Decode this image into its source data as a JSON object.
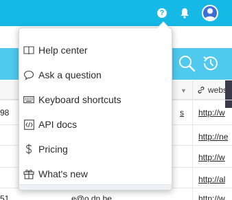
{
  "topbar": {
    "icons": [
      "help-icon",
      "bell-icon",
      "avatar"
    ],
    "help_glyph": "?",
    "accent_color": "#16b8e6",
    "status_color": "#3ccf4e"
  },
  "tools": {
    "icons": [
      "search-icon",
      "history-icon"
    ]
  },
  "grid": {
    "header_right": "webs",
    "rows": [
      {
        "left": "98",
        "mid": "s",
        "right": "http://w"
      },
      {
        "left": "",
        "mid": "",
        "right": "http://ne"
      },
      {
        "left": "",
        "mid": "",
        "right": "http://w"
      },
      {
        "left": "",
        "mid": "",
        "right": "http://al"
      },
      {
        "left": "51",
        "mid": "e@o.dn.be",
        "right": "http://w"
      }
    ]
  },
  "menu": {
    "items": [
      {
        "label": "Help center",
        "icon": "book-icon"
      },
      {
        "label": "Ask a question",
        "icon": "speech-bubble-icon"
      },
      {
        "label": "Keyboard shortcuts",
        "icon": "keyboard-icon"
      },
      {
        "label": "API docs",
        "icon": "code-icon"
      },
      {
        "label": "Pricing",
        "icon": "dollar-icon"
      },
      {
        "label": "What's new",
        "icon": "gift-icon"
      }
    ]
  }
}
